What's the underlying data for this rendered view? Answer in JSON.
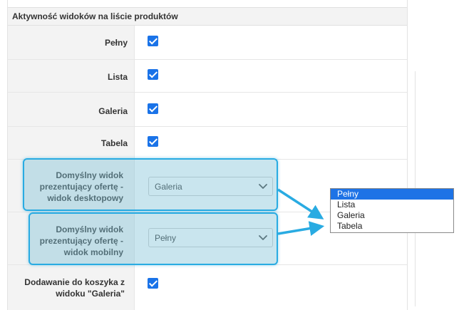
{
  "section": {
    "title": "Aktywność widoków na liście produktów"
  },
  "rows": [
    {
      "label": "Pełny",
      "checked": true
    },
    {
      "label": "Lista",
      "checked": true
    },
    {
      "label": "Galeria",
      "checked": true
    },
    {
      "label": "Tabela",
      "checked": true
    }
  ],
  "desktop_view": {
    "label": "Domyślny widok prezentujący ofertę - widok desktopowy",
    "selected": "Galeria"
  },
  "mobile_view": {
    "label": "Domyślny widok prezentujący ofertę - widok mobilny",
    "selected": "Pełny"
  },
  "cart_row": {
    "label": "Dodawanie do koszyka z widoku \"Galeria\"",
    "checked": true
  },
  "dropdown": {
    "options": [
      "Pełny",
      "Lista",
      "Galeria",
      "Tabela"
    ],
    "selected": "Pełny"
  },
  "colors": {
    "accent": "#1a73e8",
    "highlight_border": "#29abe2",
    "arrow": "#29abe2",
    "dropdown_selected": "#1e73e6"
  },
  "icons": {
    "checkbox": "checkmark-icon",
    "select": "chevron-down-icon",
    "annotation": "arrow-icon"
  }
}
